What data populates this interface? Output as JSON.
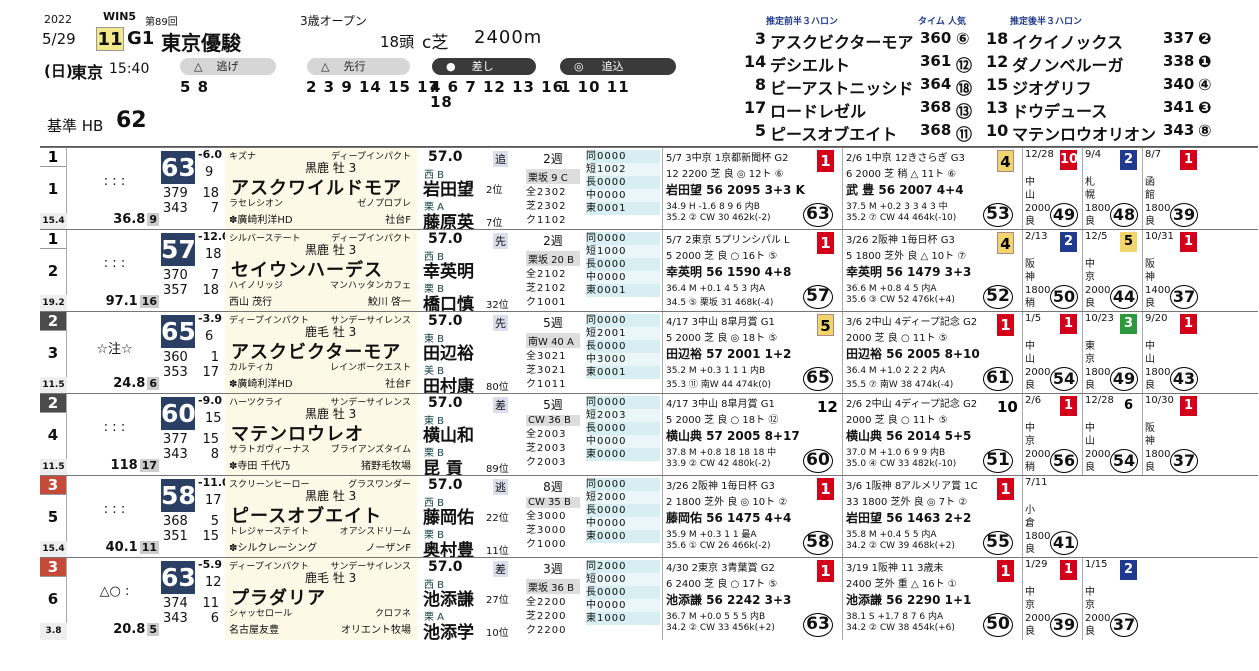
{
  "header": {
    "year": "2022",
    "date": "5/29",
    "race_no": "11",
    "grade": "G1",
    "race_name": "東京優駿",
    "series": "WIN5",
    "edition": "第89回",
    "day": "(日)",
    "course": "東京",
    "time": "15:40",
    "condition": "3歳オープン",
    "field": "18頭",
    "surface": "c芝",
    "distance": "2400m",
    "base": "基準 HB",
    "base_val": "62"
  },
  "styles": [
    {
      "label": "逃げ",
      "nums": "5 8"
    },
    {
      "label": "先行",
      "nums": "2 3 9 14 15 17"
    },
    {
      "label": "差し",
      "nums": "4 6 7 12 13 16"
    },
    {
      "label": "追込",
      "nums": "1 10 11"
    },
    {
      "label": "",
      "nums": "18"
    }
  ],
  "front3f": {
    "title": "推定前半３ハロン",
    "tcol": "タイム 人気",
    "rows": [
      {
        "no": "3",
        "name": "アスクビクターモア",
        "t": "360",
        "p": "⑥"
      },
      {
        "no": "14",
        "name": "デシエルト",
        "t": "361",
        "p": "⑫"
      },
      {
        "no": "8",
        "name": "ビーアストニッシド",
        "t": "364",
        "p": "⑱"
      },
      {
        "no": "17",
        "name": "ロードレゼル",
        "t": "368",
        "p": "⑬"
      },
      {
        "no": "5",
        "name": "ピースオブエイト",
        "t": "368",
        "p": "⑪"
      }
    ]
  },
  "back3f": {
    "title": "推定後半３ハロン",
    "rows": [
      {
        "no": "18",
        "name": "イクイノックス",
        "t": "337",
        "p": "❷"
      },
      {
        "no": "12",
        "name": "ダノンベルーガ",
        "t": "338",
        "p": "❶"
      },
      {
        "no": "15",
        "name": "ジオグリフ",
        "t": "340",
        "p": "④"
      },
      {
        "no": "13",
        "name": "ドウデュース",
        "t": "341",
        "p": "❸"
      },
      {
        "no": "10",
        "name": "マテンロウオリオン",
        "t": "343",
        "p": "⑧"
      }
    ]
  },
  "horses": [
    {
      "waku": "1",
      "no": "1",
      "bot": "15.4",
      "marks": ": : :",
      "odds": "36.8",
      "pop": "9",
      "rt": "63",
      "rtd": "-6.0",
      "rtn": "9",
      "l1": [
        "379",
        "18"
      ],
      "l2": [
        "343",
        "7"
      ],
      "sire": "キズナ",
      "sire2": "ディープインパクト",
      "color": "黒鹿 牡 3",
      "name": "アスクワイルドモア",
      "dam": "ラセレシオン",
      "dam2": "ゼノプロブレ",
      "owner": "✽廣崎利洋HD",
      "breeder": "社台F",
      "wt": "57.0",
      "style": "追",
      "ew": "西 B",
      "j1": "岩田望",
      "jr1": "2位",
      "ew2": "栗 A",
      "j2": "藤原英",
      "jr2": "7位",
      "int": "2週",
      "trn": "栗坂 9 C",
      "r": [
        "全2302",
        "芝2302",
        "ク1102"
      ],
      "rec": [
        "同0000",
        "短1002",
        "長0000",
        "中0000",
        "東0001"
      ],
      "r1": {
        "hd": "5/7 3中京 1京都新聞杯 G2",
        "fin": "1",
        "l2": "12 2200 芝 良 ◎ 12ト ⑥",
        "l3": "岩田望 56 2095 3+3 K",
        "l4": "34.9 H -1.6 8 9 6 内B",
        "l5": "35.2 ② CW 30 462k(-2)",
        "ec": "63"
      },
      "r2": {
        "hd": "2/6 1中京 12きさらぎ G3",
        "fin": "4",
        "fc": "y",
        "l2": "6 2000 芝 稍 △ 11ト ⑥",
        "l3": "武 豊 56 2007 4+4",
        "l4": "37.5 M +0.2 3 3 4 3 中",
        "l5": "35.2 ⑦ CW 44 464k(-10)",
        "ec": "53"
      },
      "s": [
        {
          "d": "12/28",
          "n": "10",
          "fc": "",
          "v": "中山 2000 良",
          "ec": "49"
        },
        {
          "d": "9/4",
          "n": "2",
          "fc": "b",
          "v": "札幌 1800 良",
          "ec": "48"
        },
        {
          "d": "8/7",
          "n": "1",
          "fc": "",
          "v": "函館 1800 良",
          "ec": "39"
        }
      ]
    },
    {
      "waku": "1",
      "no": "2",
      "bot": "19.2",
      "marks": ": : :",
      "odds": "97.1",
      "pop": "16",
      "rt": "57",
      "rtd": "-12.0",
      "rtn": "18",
      "l1": [
        "370",
        "7"
      ],
      "l2": [
        "357",
        "18"
      ],
      "sire": "シルバーステート",
      "sire2": "ディープインパクト",
      "color": "黒鹿 牡 3",
      "name": "セイウンハーデス",
      "dam": "ハイノリッジ",
      "dam2": "マンハッタンカフェ",
      "owner": "西山 茂行",
      "breeder": "鮫川 啓一",
      "wt": "57.0",
      "style": "先",
      "ew": "西 B",
      "j1": "幸英明",
      "jr1": "",
      "ew2": "栗 B",
      "j2": "橋口慎",
      "jr2": "32位",
      "int": "2週",
      "trn": "栗坂 20 B",
      "r": [
        "全2102",
        "芝2102",
        "ク1001"
      ],
      "rec": [
        "同0000",
        "短1000",
        "長0000",
        "中0000",
        "東0001"
      ],
      "r1": {
        "hd": "5/7 2東京 5プリンシパル L",
        "fin": "1",
        "l2": "5 2000 芝 良 ○ 16ト ⑤",
        "l3": "幸英明 56 1590 4+8",
        "l4": "36.4 M +0.1 4 5 3 内A",
        "l5": "34.5 ⑤ 栗坂 31 468k(-4)",
        "ec": "57"
      },
      "r2": {
        "hd": "3/26 2阪神 1毎日杯 G3",
        "fin": "4",
        "fc": "y",
        "l2": "5 1800 芝外 良 △ 10ト ⑦",
        "l3": "幸英明 56 1479 3+3",
        "l4": "36.6 M +0.8 4 5 内A",
        "l5": "35.6 ③ CW 52 476k(+4)",
        "ec": "52"
      },
      "s": [
        {
          "d": "2/13",
          "n": "2",
          "fc": "b",
          "v": "阪神 1800 稍",
          "ec": "50"
        },
        {
          "d": "12/5",
          "n": "5",
          "fc": "y",
          "v": "中京 2000 良",
          "ec": "44"
        },
        {
          "d": "10/31",
          "n": "1",
          "fc": "",
          "v": "阪神 1400 良",
          "ec": "37"
        }
      ]
    },
    {
      "waku": "2",
      "no": "3",
      "bot": "11.5",
      "marks": "☆注☆",
      "odds": "24.8",
      "pop": "6",
      "rt": "65",
      "rtd": "-3.9",
      "rtn": "6",
      "l1": [
        "360",
        "1"
      ],
      "l2": [
        "353",
        "17"
      ],
      "sire": "ディープインパクト",
      "sire2": "サンデーサイレンス",
      "color": "鹿毛 牡 3",
      "name": "アスクビクターモア",
      "dam": "カルティカ",
      "dam2": "レインボークエスト",
      "owner": "✽廣崎利洋HD",
      "breeder": "社台F",
      "wt": "57.0",
      "style": "先",
      "ew": "東 B",
      "j1": "田辺裕",
      "jr1": "",
      "ew2": "美 B",
      "j2": "田村康",
      "jr2": "80位",
      "int": "5週",
      "trn": "南W 40 A",
      "r": [
        "全3021",
        "芝3021",
        "ク1011"
      ],
      "rec": [
        "同0000",
        "短2001",
        "長0000",
        "中3000",
        "東0001"
      ],
      "r1": {
        "hd": "4/17 3中山 8皐月賞 G1",
        "fin": "5",
        "fc": "y",
        "l2": "5 2000 芝 良 ◎ 18ト ⑤",
        "l3": "田辺裕 57 2001 1+2",
        "l4": "35.2 M +0.3 1 1 1 内B",
        "l5": "35.3 ⑪ 南W 44 474k(0)",
        "ec": "65"
      },
      "r2": {
        "hd": "3/6 2中山 4ディープ記念 G2",
        "fin": "1",
        "l2": "2000 芝 良 ○ 11ト ⑤",
        "l3": "田辺裕 56 2005 8+10",
        "l4": "36.4 M +1.0 2 2 2 内A",
        "l5": "35.5 ⑦ 南W 38 474k(-4)",
        "ec": "61"
      },
      "s": [
        {
          "d": "1/5",
          "n": "1",
          "fc": "",
          "v": "中山 2000 良",
          "ec": "54"
        },
        {
          "d": "10/23",
          "n": "3",
          "fc": "gr",
          "v": "東京 1800 良",
          "ec": "49"
        },
        {
          "d": "9/20",
          "n": "1",
          "fc": "",
          "v": "中山 1800 良",
          "ec": "43"
        }
      ]
    },
    {
      "waku": "2",
      "no": "4",
      "bot": "11.5",
      "marks": ": : :",
      "odds": "118",
      "pop": "17",
      "rt": "60",
      "rtd": "-9.0",
      "rtn": "15",
      "l1": [
        "377",
        "15"
      ],
      "l2": [
        "343",
        "8"
      ],
      "sire": "ハーツクライ",
      "sire2": "サンデーサイレンス",
      "color": "黒鹿 牡 3",
      "name": "マテンロウレオ",
      "dam": "サラトガヴィーナス",
      "dam2": "ブライアンズタイム",
      "owner": "✽寺田 千代乃",
      "breeder": "猪野毛牧場",
      "wt": "57.0",
      "style": "差",
      "ew": "東 B",
      "j1": "横山和",
      "jr1": "",
      "ew2": "栗 B",
      "j2": "昆 貢",
      "jr2": "89位",
      "int": "5週",
      "trn": "CW 36 B",
      "r": [
        "全2003",
        "芝2003",
        "ク2003"
      ],
      "rec": [
        "同0000",
        "短2003",
        "長0000",
        "中0000",
        "東0000"
      ],
      "r1": {
        "hd": "4/17 3中山 8皐月賞 G1",
        "fin": "12",
        "fc": "w",
        "l2": "5 2000 芝 良 ○ 18ト ⑫",
        "l3": "横山典 57 2005 8+17",
        "l4": "37.8 M +0.8 18 18 18 中",
        "l5": "33.9 ② CW 42 480k(-2)",
        "ec": "60"
      },
      "r2": {
        "hd": "2/6 2中山 4ディープ記念 G2",
        "fin": "10",
        "fc": "w",
        "l2": "2000 芝 良 ○ 11ト ⑤",
        "l3": "横山典 56 2014 5+5",
        "l4": "37.0 M +1.0 6 9 9 内B",
        "l5": "35.0 ④ CW 33 482k(-10)",
        "ec": "51"
      },
      "s": [
        {
          "d": "2/6",
          "n": "1",
          "fc": "",
          "v": "中京 2000 稍",
          "ec": "56"
        },
        {
          "d": "12/28",
          "n": "6",
          "fc": "w",
          "v": "中山 2000 良",
          "ec": "54"
        },
        {
          "d": "10/30",
          "n": "1",
          "fc": "",
          "v": "阪神 1800 良",
          "ec": "37"
        }
      ]
    },
    {
      "waku": "3",
      "no": "5",
      "bot": "15.4",
      "marks": ": : :",
      "odds": "40.1",
      "pop": "11",
      "rt": "58",
      "rtd": "-11.0",
      "rtn": "17",
      "l1": [
        "368",
        "5"
      ],
      "l2": [
        "351",
        "15"
      ],
      "sire": "スクリーンヒーロー",
      "sire2": "グラスワンダー",
      "color": "黒鹿 牡 3",
      "name": "ピースオブエイト",
      "dam": "トレジャーステイト",
      "dam2": "オアシスドリーム",
      "owner": "✽シルクレーシング",
      "breeder": "ノーザンF",
      "wt": "57.0",
      "style": "逃",
      "ew": "西 B",
      "j1": "藤岡佑",
      "jr1": "22位",
      "ew2": "栗 B",
      "j2": "奥村豊",
      "jr2": "11位",
      "int": "8週",
      "trn": "CW 35 B",
      "r": [
        "全3000",
        "芝3000",
        "ク1000"
      ],
      "rec": [
        "同0000",
        "短2000",
        "長0000",
        "中0000",
        "東0000"
      ],
      "r1": {
        "hd": "3/26 2阪神 1毎日杯 G3",
        "fin": "1",
        "l2": "2 1800 芝外 良 ◎ 10ト ②",
        "l3": "藤岡佑 56 1475 4+4",
        "l4": "35.9 M +0.3 1 1 最A",
        "l5": "35.6 ① CW 26 466k(-2)",
        "ec": "58"
      },
      "r2": {
        "hd": "3/6 1阪神 8アルメリア賞 1C",
        "fin": "1",
        "l2": "33 1800 芝外 良 ◎ 7ト ②",
        "l3": "岩田望 56 1463 2+2",
        "l4": "35.8 M +0.4 5 5 内A",
        "l5": "34.2 ② CW 39 468k(+2)",
        "ec": "55"
      },
      "s": [
        {
          "d": "7/11",
          "n": "",
          "fc": "",
          "v": "小倉 1800 良",
          "ec": "41"
        }
      ]
    },
    {
      "waku": "3",
      "no": "6",
      "bot": "3.8",
      "marks": "△○ :",
      "odds": "20.8",
      "pop": "5",
      "rt": "63",
      "rtd": "-5.9",
      "rtn": "12",
      "l1": [
        "374",
        "11"
      ],
      "l2": [
        "343",
        "6"
      ],
      "sire": "ディープインパクト",
      "sire2": "サンデーサイレンス",
      "color": "鹿毛 牡 3",
      "name": "プラダリア",
      "dam": "シャッセロール",
      "dam2": "クロフネ",
      "owner": "名古屋友豊",
      "breeder": "オリエント牧場",
      "wt": "57.0",
      "style": "差",
      "ew": "西 B",
      "j1": "池添謙",
      "jr1": "27位",
      "ew2": "栗 A",
      "j2": "池添学",
      "jr2": "10位",
      "int": "3週",
      "trn": "栗坂 36 B",
      "r": [
        "全2200",
        "芝2200",
        "ク2200"
      ],
      "rec": [
        "同2000",
        "短0000",
        "長0000",
        "中0000",
        "東1000"
      ],
      "r1": {
        "hd": "4/30 2東京 3青葉賞 G2",
        "fin": "1",
        "l2": "6 2400 芝 良 ○ 17ト ⑤",
        "l3": "池添謙 56 2242 3+3",
        "l4": "36.7 M +0.0 5 5 5 内B",
        "l5": "34.2 ② CW 33 456k(+2)",
        "ec": "63"
      },
      "r2": {
        "hd": "3/19 1阪神 11 3歳未",
        "fin": "1",
        "l2": "2400 芝外 重 △ 16ト ①",
        "l3": "池添謙 56 2290 1+1",
        "l4": "38.1 S +1.7 8 7 6 内A",
        "l5": "34.2 ② CW 38 454k(+6)",
        "ec": "50"
      },
      "s": [
        {
          "d": "1/29",
          "n": "1",
          "fc": "",
          "v": "中京 2000 良",
          "ec": "39"
        },
        {
          "d": "1/15",
          "n": "2",
          "fc": "b",
          "v": "中京 2000 良",
          "ec": "37"
        }
      ]
    }
  ]
}
